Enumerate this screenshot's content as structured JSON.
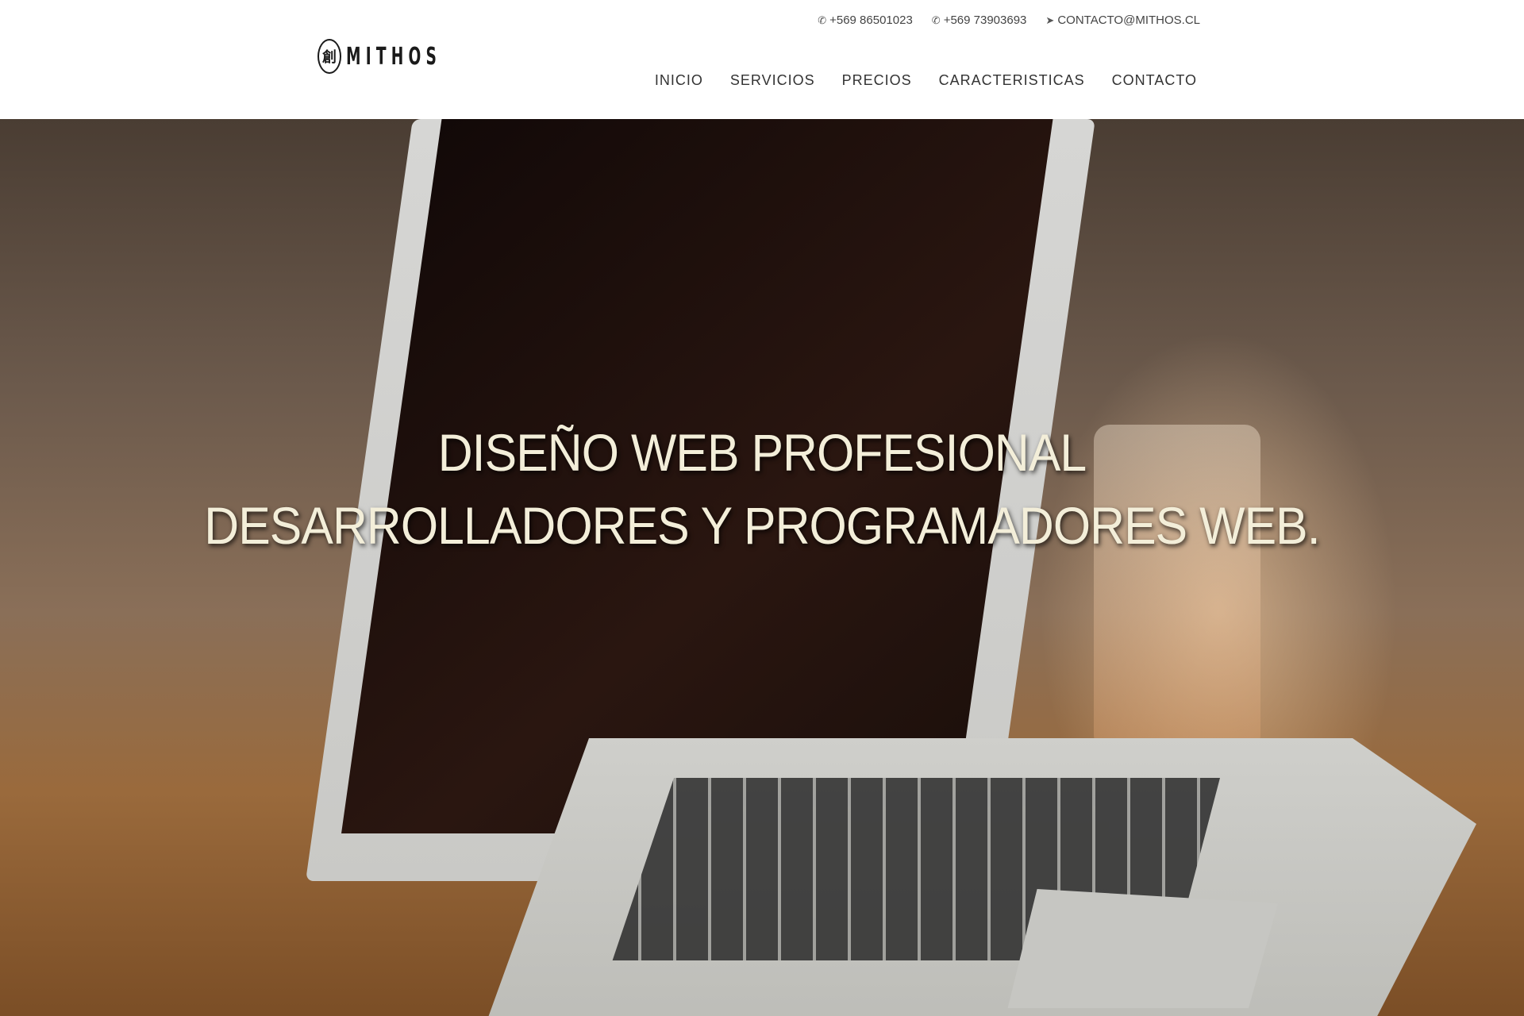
{
  "brand": {
    "logo_text": "MITHOS"
  },
  "topbar": {
    "phone1": "+569 86501023",
    "phone2": "+569 73903693",
    "email": "CONTACTO@MITHOS.CL"
  },
  "nav": {
    "items": [
      "INICIO",
      "SERVICIOS",
      "PRECIOS",
      "CARACTERISTICAS",
      "CONTACTO"
    ]
  },
  "hero": {
    "title_line1": "DISEÑO WEB PROFESIONAL",
    "title_line2": "DESARROLLADORES Y PROGRAMADORES WEB."
  },
  "icons": {
    "phone": "whatsapp-icon",
    "email": "paper-plane-icon"
  },
  "colors": {
    "header_bg": "#ffffff",
    "nav_text": "#333333",
    "hero_text": "#f3eed9"
  }
}
